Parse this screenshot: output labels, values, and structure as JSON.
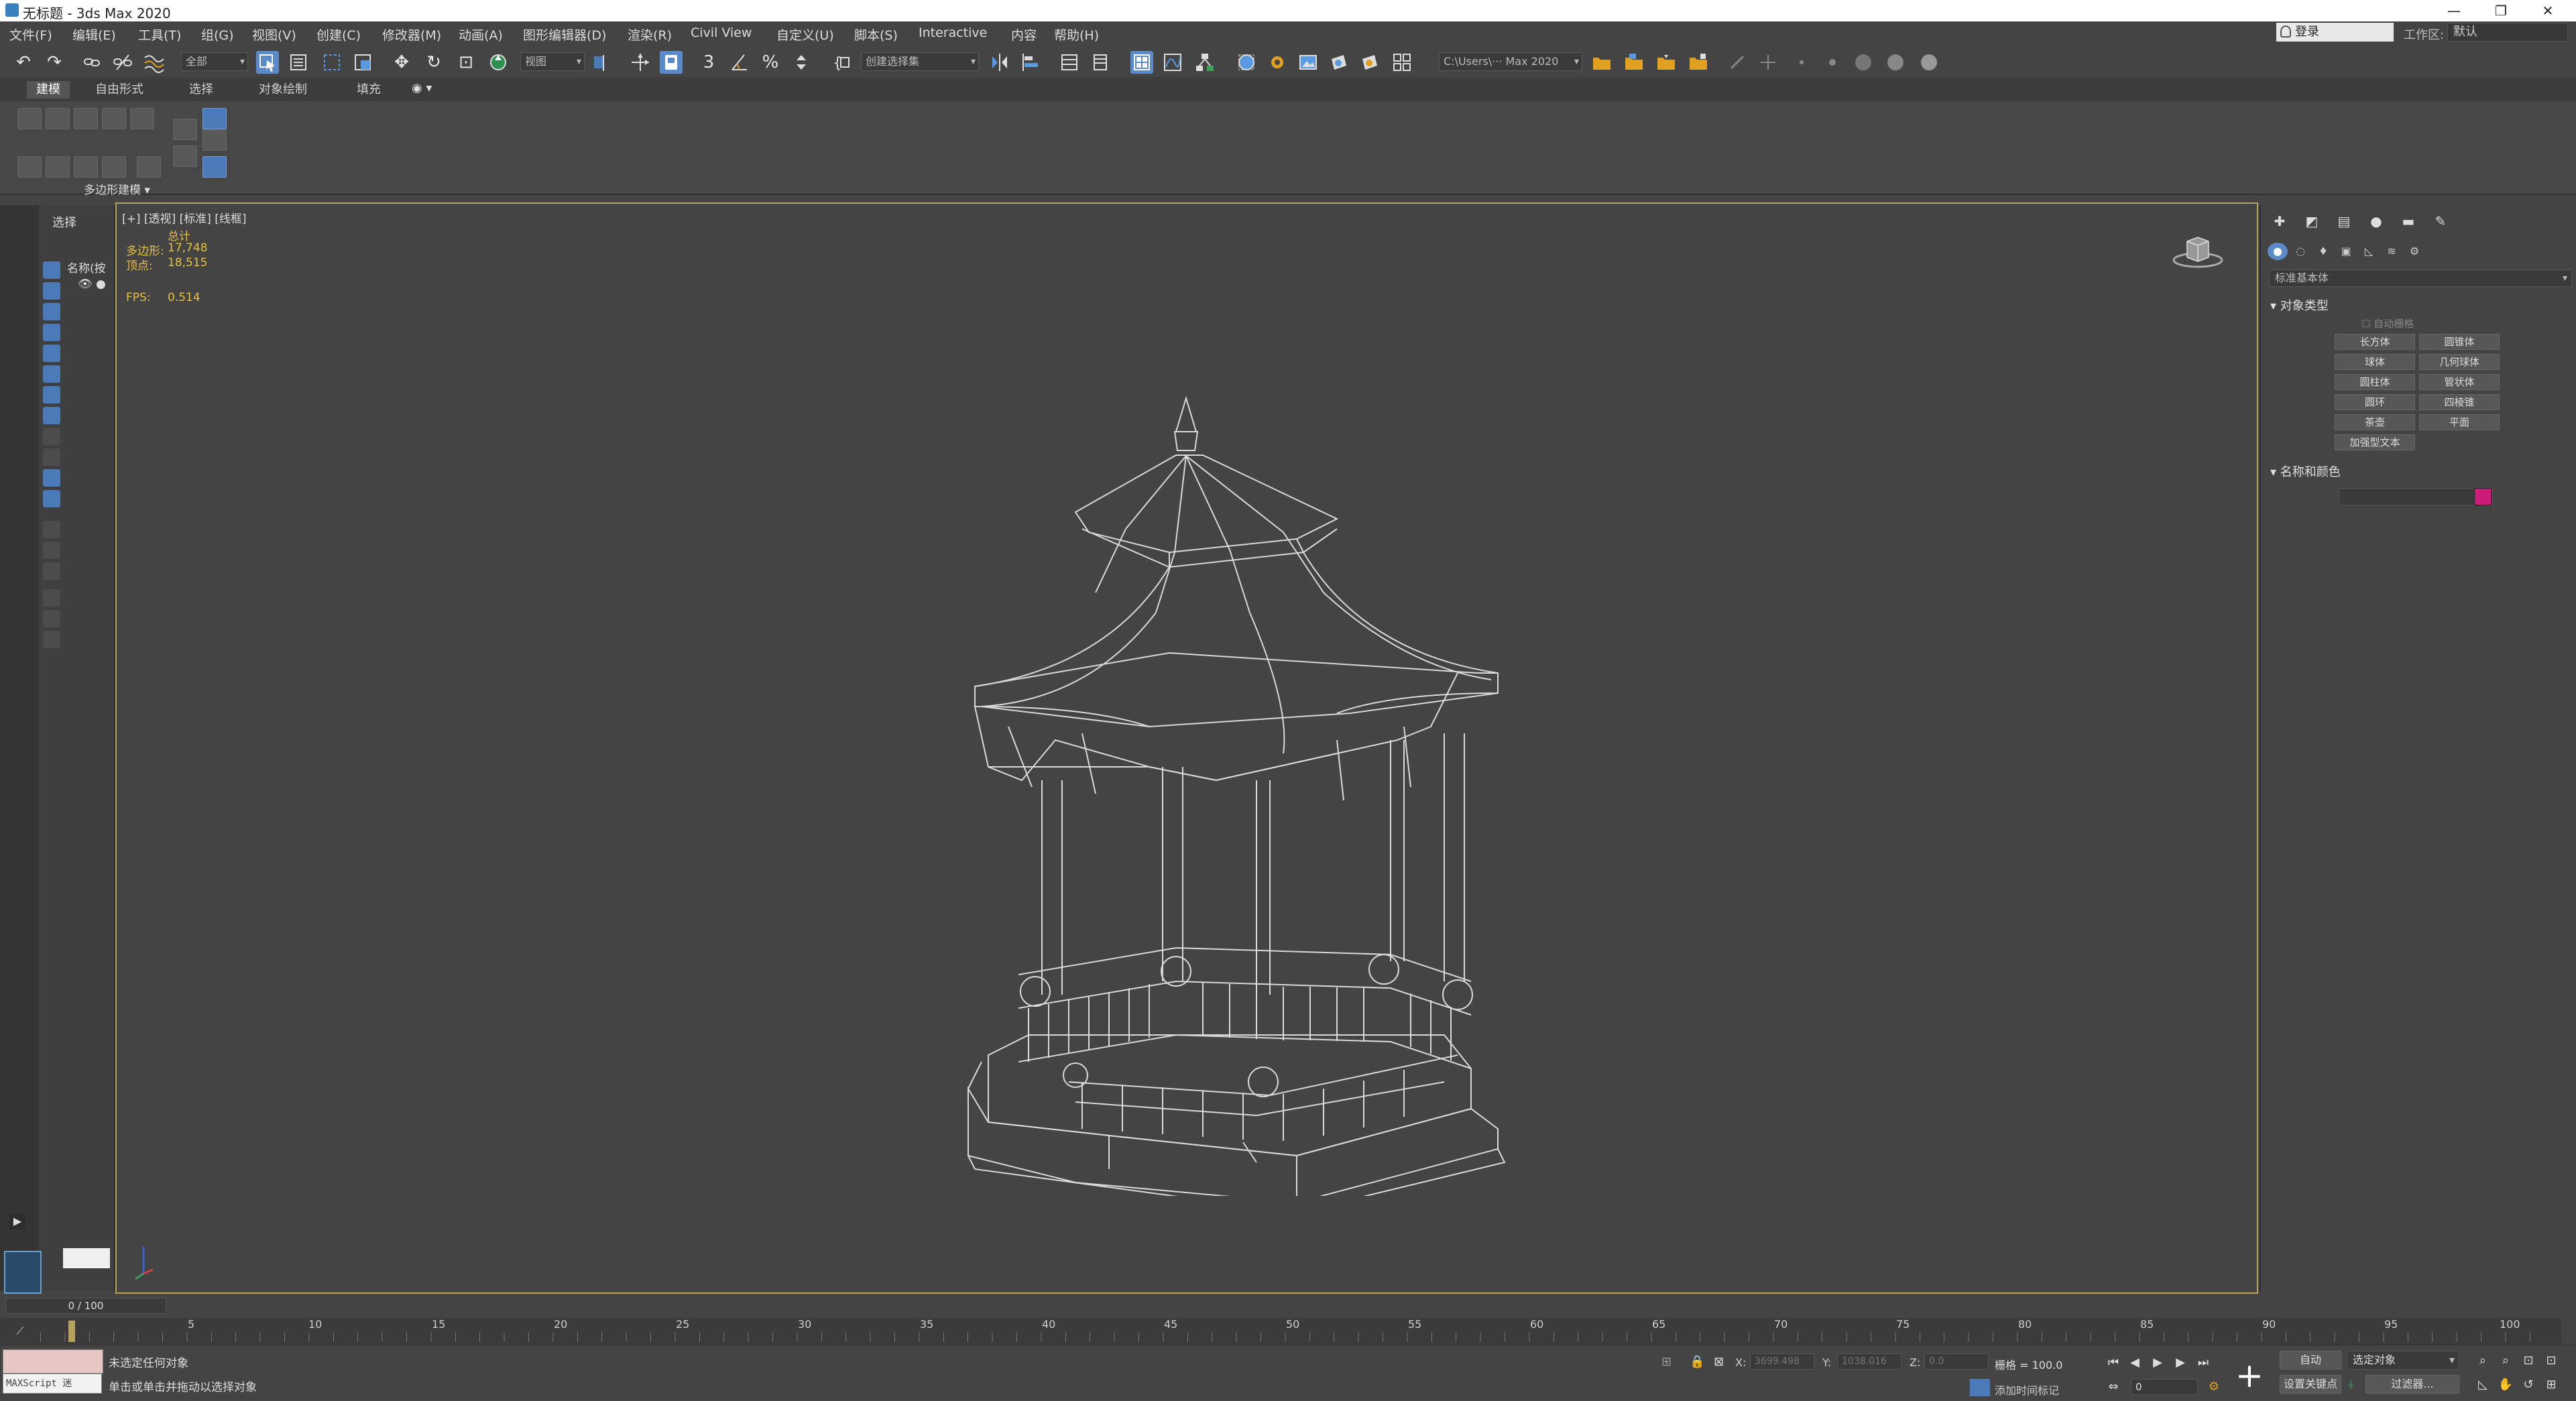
{
  "window": {
    "title": "无标题 - 3ds Max 2020",
    "controls": [
      "—",
      "❐",
      "✕"
    ]
  },
  "menu": {
    "items": [
      "文件(F)",
      "编辑(E)",
      "工具(T)",
      "组(G)",
      "视图(V)",
      "创建(C)",
      "修改器(M)",
      "动画(A)",
      "图形编辑器(D)",
      "渲染(R)",
      "Civil View",
      "自定义(U)",
      "脚本(S)",
      "Interactive",
      "内容",
      "帮助(H)"
    ],
    "login": "登录",
    "workspace_label": "工作区:",
    "workspace_value": "默认"
  },
  "toolbar": {
    "filter_value": "全部",
    "refcoord_value": "视图",
    "selection_set": "创建选择集",
    "path_value": "C:\\Users\\··· Max 2020",
    "icons": [
      "undo-icon",
      "redo-icon",
      "link-icon",
      "unlink-icon",
      "bind-spacewarp-icon",
      "select-object-icon",
      "select-by-name-icon",
      "rect-region-icon",
      "window-crossing-icon",
      "move-icon",
      "rotate-icon",
      "scale-icon",
      "placement-icon",
      "pivot-icon",
      "manipulate-icon",
      "snap-3d-icon",
      "angle-snap-icon",
      "percent-snap-icon",
      "spinner-snap-icon",
      "edit-named-sets-icon",
      "mirror-icon",
      "align-icon",
      "scene-explorer-icon",
      "layer-explorer-icon",
      "ribbon-toggle-icon",
      "curve-editor-icon",
      "schematic-view-icon",
      "material-editor-icon",
      "render-setup-icon",
      "rendered-frame-icon",
      "render-icon",
      "render-iterative-icon"
    ],
    "undo_glyph": "↶",
    "redo_glyph": "↷",
    "move_glyph": "✥",
    "rotate_glyph": "↻",
    "snap3_glyph": "3",
    "percent_glyph": "%",
    "scale_glyph": "⊡"
  },
  "ribbon": {
    "tabs": [
      "建模",
      "自由形式",
      "选择",
      "对象绘制",
      "填充"
    ],
    "panel_label": "多边形建模 ▾"
  },
  "scene_explorer": {
    "tab": "选择",
    "column": "名称(按",
    "eye": "👁 ●"
  },
  "viewport": {
    "label": "[+] [透视] [标准] [线框]",
    "stats": {
      "total_label": "总计",
      "polys_label": "多边形:",
      "polys_value": "17,748",
      "verts_label": "顶点:",
      "verts_value": "18,515",
      "fps_label": "FPS:",
      "fps_value": "0.514"
    }
  },
  "command_panel": {
    "category": "标准基本体",
    "object_type_title": "对象类型",
    "autogrid": "☐ 自动栅格",
    "buttons": [
      "长方体",
      "圆锥体",
      "球体",
      "几何球体",
      "圆柱体",
      "管状体",
      "圆环",
      "四棱锥",
      "茶壶",
      "平面",
      "加强型文本"
    ],
    "name_color_title": "名称和颜色",
    "object_color": "#cc1c7a"
  },
  "timeline": {
    "slider": "0 / 100",
    "ticks": [
      "5",
      "10",
      "15",
      "20",
      "25",
      "30",
      "35",
      "40",
      "45",
      "50",
      "55",
      "60",
      "65",
      "70",
      "75",
      "80",
      "85",
      "90",
      "95",
      "100"
    ]
  },
  "status": {
    "maxscript": "MAXScript 迷",
    "line1": "未选定任何对象",
    "line2": "单击或单击并拖动以选择对象",
    "x_label": "X:",
    "x_value": "3699.498",
    "y_label": "Y:",
    "y_value": "1038.016",
    "z_label": "Z:",
    "z_value": "0.0",
    "grid": "栅格 = 100.0",
    "add_time_tag": "添加时间标记",
    "auto_key": "自动",
    "selected": "选定对象",
    "set_key": "设置关键点",
    "filters": "过滤器...",
    "frame": "0"
  }
}
